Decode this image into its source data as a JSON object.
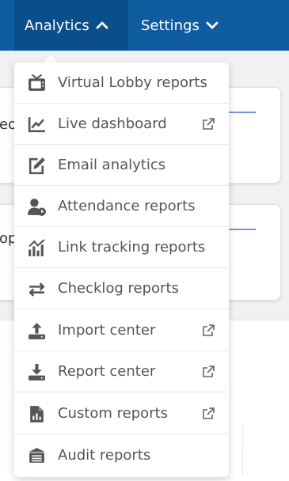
{
  "nav": {
    "analytics_label": "Analytics",
    "settings_label": "Settings"
  },
  "background": {
    "card1_fragment": "eo",
    "card2_fragment": "op"
  },
  "menu": {
    "items": [
      {
        "label": "Virtual Lobby reports",
        "icon": "tv-icon",
        "external": false
      },
      {
        "label": "Live dashboard",
        "icon": "line-chart-icon",
        "external": true
      },
      {
        "label": "Email analytics",
        "icon": "edit-icon",
        "external": false
      },
      {
        "label": "Attendance reports",
        "icon": "user-clock-icon",
        "external": false
      },
      {
        "label": "Link tracking reports",
        "icon": "link-chart-icon",
        "external": false
      },
      {
        "label": "Checklog reports",
        "icon": "exchange-icon",
        "external": false
      },
      {
        "label": "Import center",
        "icon": "upload-icon",
        "external": true
      },
      {
        "label": "Report center",
        "icon": "download-icon",
        "external": true
      },
      {
        "label": "Custom reports",
        "icon": "file-chart-icon",
        "external": true
      },
      {
        "label": "Audit reports",
        "icon": "archive-icon",
        "external": false
      }
    ]
  },
  "colors": {
    "nav_bg": "#0f5ca0",
    "nav_active_bg": "#0a4f8c",
    "menu_text": "#555555",
    "icon_color": "#555555",
    "card_accent": "#7b8fe0"
  }
}
